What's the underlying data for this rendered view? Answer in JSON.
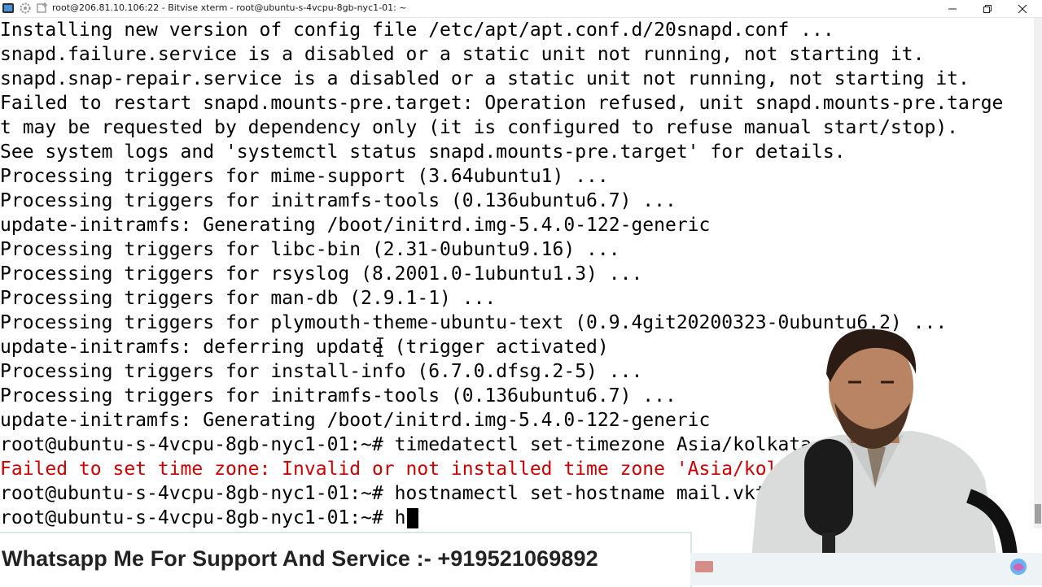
{
  "window": {
    "title": "root@206.81.10.106:22 - Bitvise xterm - root@ubuntu-s-4vcpu-8gb-nyc1-01: ~",
    "icons": [
      "xterm-app-icon",
      "settings-icon",
      "new-window-icon"
    ],
    "controls": [
      "minimize-icon",
      "restore-icon",
      "close-icon"
    ]
  },
  "terminal": {
    "lines": [
      {
        "text": "Installing new version of config file /etc/apt/apt.conf.d/20snapd.conf ...",
        "type": "normal"
      },
      {
        "text": "snapd.failure.service is a disabled or a static unit not running, not starting it.",
        "type": "normal"
      },
      {
        "text": "snapd.snap-repair.service is a disabled or a static unit not running, not starting it.",
        "type": "normal"
      },
      {
        "text": "Failed to restart snapd.mounts-pre.target: Operation refused, unit snapd.mounts-pre.targe",
        "type": "normal"
      },
      {
        "text": "t may be requested by dependency only (it is configured to refuse manual start/stop).",
        "type": "normal"
      },
      {
        "text": "See system logs and 'systemctl status snapd.mounts-pre.target' for details.",
        "type": "normal"
      },
      {
        "text": "Processing triggers for mime-support (3.64ubuntu1) ...",
        "type": "normal"
      },
      {
        "text": "Processing triggers for initramfs-tools (0.136ubuntu6.7) ...",
        "type": "normal"
      },
      {
        "text": "update-initramfs: Generating /boot/initrd.img-5.4.0-122-generic",
        "type": "normal"
      },
      {
        "text": "Processing triggers for libc-bin (2.31-0ubuntu9.16) ...",
        "type": "normal"
      },
      {
        "text": "Processing triggers for rsyslog (8.2001.0-1ubuntu1.3) ...",
        "type": "normal"
      },
      {
        "text": "Processing triggers for man-db (2.9.1-1) ...",
        "type": "normal"
      },
      {
        "text": "Processing triggers for plymouth-theme-ubuntu-text (0.9.4git20200323-0ubuntu6.2) ...",
        "type": "normal"
      },
      {
        "text": "update-initramfs: deferring update (trigger activated)",
        "type": "normal"
      },
      {
        "text": "Processing triggers for install-info (6.7.0.dfsg.2-5) ...",
        "type": "normal"
      },
      {
        "text": "Processing triggers for initramfs-tools (0.136ubuntu6.7) ...",
        "type": "normal"
      },
      {
        "text": "update-initramfs: Generating /boot/initrd.img-5.4.0-122-generic",
        "type": "normal"
      },
      {
        "text": "root@ubuntu-s-4vcpu-8gb-nyc1-01:~# timedatectl set-timezone Asia/kolkata",
        "type": "normal"
      },
      {
        "text": "Failed to set time zone: Invalid or not installed time zone 'Asia/kolka",
        "type": "error"
      },
      {
        "text": "root@ubuntu-s-4vcpu-8gb-nyc1-01:~# hostnamectl set-hostname mail.vkt",
        "type": "normal"
      },
      {
        "text": "root@ubuntu-s-4vcpu-8gb-nyc1-01:~# h",
        "type": "prompt"
      }
    ],
    "colors": {
      "text": "#000000",
      "error": "#cc0000",
      "background": "#ffffff"
    }
  },
  "banner": {
    "text": "Whatsapp Me For Support And Service :- +919521069892"
  }
}
